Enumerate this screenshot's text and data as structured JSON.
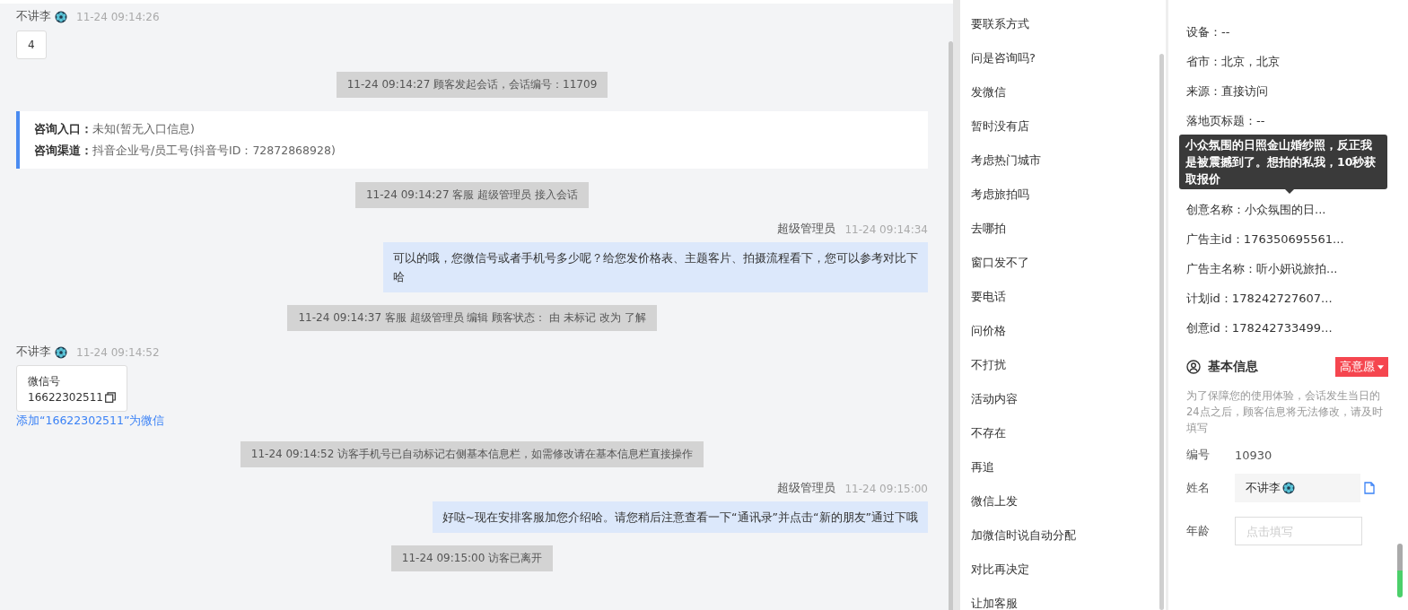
{
  "chat": {
    "messages": [
      {
        "kind": "customer",
        "name": "不讲李",
        "time": "11-24 09:14:26",
        "text": "4"
      },
      {
        "kind": "system",
        "text": "11-24 09:14:27 顾客发起会话，会话编号：11709"
      },
      {
        "kind": "entry",
        "lines": [
          {
            "label": "咨询入口：",
            "value": "未知(暂无入口信息)"
          },
          {
            "label": "咨询渠道：",
            "value": "抖音企业号/员工号(抖音号ID：72872868928)"
          }
        ]
      },
      {
        "kind": "system",
        "text": "11-24 09:14:27 客服 超级管理员 接入会话"
      },
      {
        "kind": "agent",
        "name": "超级管理员",
        "time": "11-24 09:14:34",
        "text": "可以的哦，您微信号或者手机号多少呢？给您发价格表、主题客片、拍摄流程看下，您可以参考对比下哈"
      },
      {
        "kind": "system",
        "text": "11-24 09:14:37 客服 超级管理员 编辑 顾客状态： 由 未标记 改为 了解"
      },
      {
        "kind": "wechat",
        "name": "不讲李",
        "time": "11-24 09:14:52",
        "title": "微信号",
        "number": "16622302511",
        "link": "添加“16622302511”为微信"
      },
      {
        "kind": "system",
        "text": "11-24 09:14:52 访客手机号已自动标记右侧基本信息栏，如需修改请在基本信息栏直接操作"
      },
      {
        "kind": "agent",
        "name": "超级管理员",
        "time": "11-24 09:15:00",
        "text": "好哒~现在安排客服加您介绍哈。请您稍后注意查看一下“通讯录”并点击“新的朋友”通过下哦"
      },
      {
        "kind": "system",
        "text": "11-24 09:15:00 访客已离开"
      }
    ]
  },
  "quick_replies": [
    "要联系方式",
    "问是咨询吗?",
    "发微信",
    "暂时没有店",
    "考虑热门城市",
    "考虑旅拍吗",
    "去哪拍",
    "窗口发不了",
    "要电话",
    "问价格",
    "不打扰",
    "活动内容",
    "不存在",
    "再追",
    "微信上发",
    "加微信时说自动分配",
    "对比再决定",
    "让加客服"
  ],
  "source_info": {
    "rows": [
      "设备：--",
      "省市：北京，北京",
      "来源：直接访问",
      "落地页标题：--"
    ],
    "rows_after_tooltip": [
      "创意名称：小众氛围的日...",
      "广告主id：176350695561...",
      "广告主名称：听小妍说旅拍...",
      "计划id：178242727607...",
      "创意id：178242733499..."
    ],
    "tooltip": "小众氛围的日照金山婚纱照，反正我是被震撼到了。想拍的私我，10秒获取报价"
  },
  "basic_info": {
    "title": "基本信息",
    "intent": {
      "label": "高意愿",
      "color": "#f5464f"
    },
    "notice": "为了保障您的使用体验，会话发生当日的24点之后，顾客信息将无法修改，请及时填写",
    "fields": [
      {
        "kind": "text",
        "label": "编号",
        "value": "10930"
      },
      {
        "kind": "name",
        "label": "姓名",
        "value": "不讲李"
      },
      {
        "kind": "input",
        "label": "年龄",
        "placeholder": "点击填写"
      }
    ]
  }
}
